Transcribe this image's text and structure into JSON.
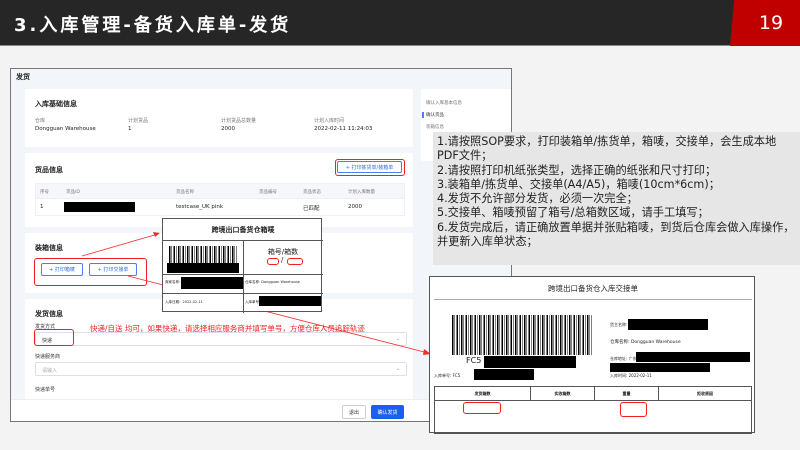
{
  "slide": {
    "title": "3.入库管理-备货入库单-发货",
    "page": "19"
  },
  "window": {
    "title": "发货"
  },
  "basic": {
    "title": "入库基础信息",
    "fields": [
      {
        "label": "仓库",
        "value": "Dongguan Warehouse"
      },
      {
        "label": "计划货品",
        "value": "1"
      },
      {
        "label": "计划货品总数量",
        "value": "2000"
      },
      {
        "label": "计划入库时间",
        "value": "2022-02-11 11:24:03"
      }
    ]
  },
  "side_nav": [
    "确认入库基本信息",
    "确认货品",
    "装箱信息"
  ],
  "goods": {
    "title": "货品信息",
    "print_button": "+ 打印拣货单/装箱单",
    "headers": [
      "序号",
      "货品ID",
      "货品名称",
      "货品编号",
      "货品状态",
      "计划入库数量"
    ],
    "rows": [
      [
        "1",
        "",
        "testcase_UK pink",
        "",
        "已匹配",
        "2000"
      ]
    ]
  },
  "packing": {
    "title": "装箱信息",
    "print_label": "+ 打印箱唛",
    "print_handover": "+ 打印交接单"
  },
  "ship": {
    "title": "发货信息",
    "method_label": "发货方式",
    "method_value": "快递",
    "carrier_label": "快递服务商",
    "carrier_placeholder": "请输入",
    "tracking_label": "快递单号"
  },
  "footer": {
    "exit": "退出",
    "confirm": "确认发货"
  },
  "annotation": "快递/自送 均可，如果快递，请选择相应服务商并填写单号，方便仓库人员追踪轨迹",
  "label_doc": {
    "title": "跨境出口备货仓箱唛",
    "box_no": "箱号/箱数",
    "slash": "/",
    "merchant": "商家名称:",
    "warehouse": "仓库名称: Dongguan Warehouse",
    "date": "入库日期：2022-02-11",
    "order": "入库单号:"
  },
  "handover_doc": {
    "title": "跨境出口备货仓入库交接单",
    "code_prefix": "FC5",
    "owner": "货主名称:",
    "warehouse": "仓库名称: Dongguan Warehouse",
    "address": "仓库地址: 广东省",
    "order": "入库单号: FC5",
    "time": "入库时间: 2022-02-11",
    "cols": [
      "发货箱数",
      "实收箱数",
      "重量",
      "拒收原因"
    ]
  },
  "notes": [
    "1.请按照SOP要求，打印装箱单/拣货单，箱唛，交接单，会生成本地PDF文件；",
    "2.请按照打印机纸张类型，选择正确的纸张和尺寸打印；",
    "3.装箱单/拣货单、交接单(A4/A5)，箱唛(10cm*6cm)；",
    "4.发货不允许部分发货，必须一次完全；",
    "5.交接单、箱唛预留了箱号/总箱数区域，请手工填写；",
    "6.发货完成后，请正确放置单据并张贴箱唛，到货后仓库会做入库操作，并更新入库单状态；"
  ]
}
